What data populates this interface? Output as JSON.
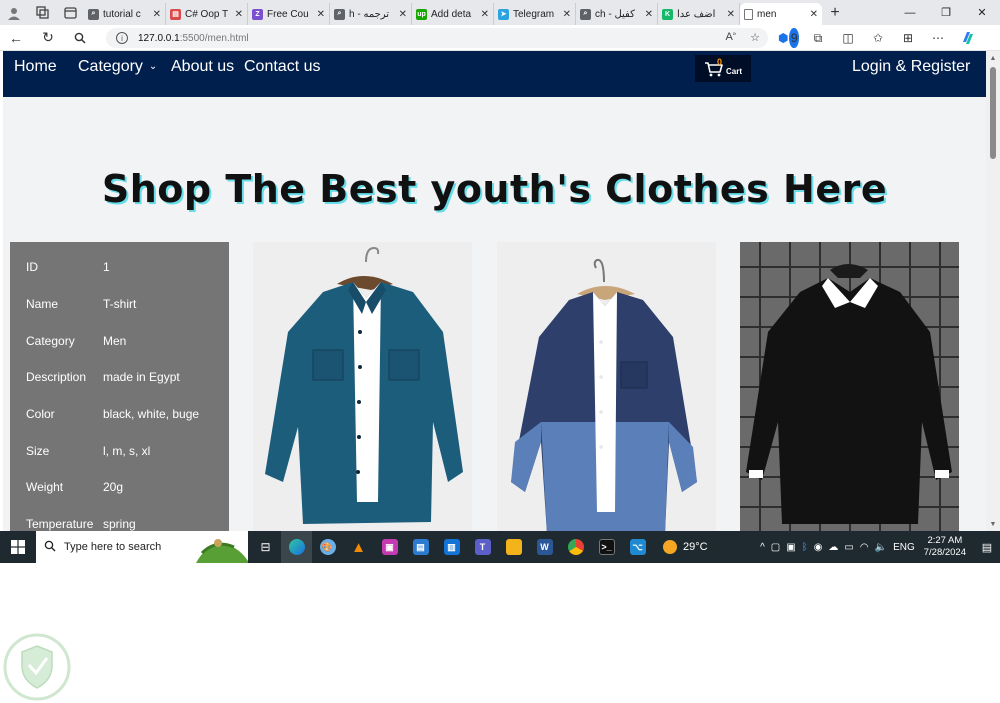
{
  "browser": {
    "tabs": [
      {
        "label": "tutorial c",
        "fav_color": "#5f6368",
        "fav_glyph": "⌕"
      },
      {
        "label": "C# Oop T",
        "fav_color": "#d94b4b",
        "fav_glyph": "▤"
      },
      {
        "label": "Free Cou",
        "fav_color": "#7a4fd0",
        "fav_glyph": "Z"
      },
      {
        "label": "h - ترجمه",
        "fav_color": "#5f6368",
        "fav_glyph": "⌕"
      },
      {
        "label": "Add deta",
        "fav_color": "#14a800",
        "fav_glyph": "up"
      },
      {
        "label": "Telegram",
        "fav_color": "#2aa3e0",
        "fav_glyph": "➤"
      },
      {
        "label": "ch - كفيل",
        "fav_color": "#5f6368",
        "fav_glyph": "⌕"
      },
      {
        "label": "أضف عدا",
        "fav_color": "#16b86a",
        "fav_glyph": "K"
      }
    ],
    "active_tab": {
      "label": "men"
    },
    "new_tab_icon": "+",
    "url_host": "127.0.0.1",
    "url_path": ":5500/men.html",
    "extension_badge": "9"
  },
  "nav": {
    "home": "Home",
    "category": "Category",
    "about": "About us",
    "contact": "Contact us",
    "cart_count": "0",
    "cart_label": "Cart",
    "login": "Login & Register"
  },
  "hero": {
    "title": "Shop The Best youth's Clothes Here"
  },
  "product_info": [
    {
      "key": "ID",
      "value": "1"
    },
    {
      "key": "Name",
      "value": "T-shirt"
    },
    {
      "key": "Category",
      "value": "Men"
    },
    {
      "key": "Description",
      "value": "made in Egypt"
    },
    {
      "key": "Color",
      "value": "black, white, buge"
    },
    {
      "key": "Size",
      "value": "l, m, s, xl"
    },
    {
      "key": "Weight",
      "value": "20g"
    },
    {
      "key": "Temperature",
      "value": "spring"
    }
  ],
  "products": [
    {
      "name": "teal-corduroy-shirt",
      "color": "#1d5d7c"
    },
    {
      "name": "two-tone-denim-shirt",
      "color": "#2d3f6a"
    },
    {
      "name": "black-sweater-collar",
      "color": "#121212"
    }
  ],
  "taskbar": {
    "search_placeholder": "Type here to search",
    "weather": "29°C",
    "lang": "ENG",
    "time": "2:27 AM",
    "date": "7/28/2024"
  },
  "colors": {
    "navbar": "#001f4d",
    "page_bg": "#f2f3f5",
    "info_panel": "#757575",
    "hero_shadow": "#66dde8"
  }
}
